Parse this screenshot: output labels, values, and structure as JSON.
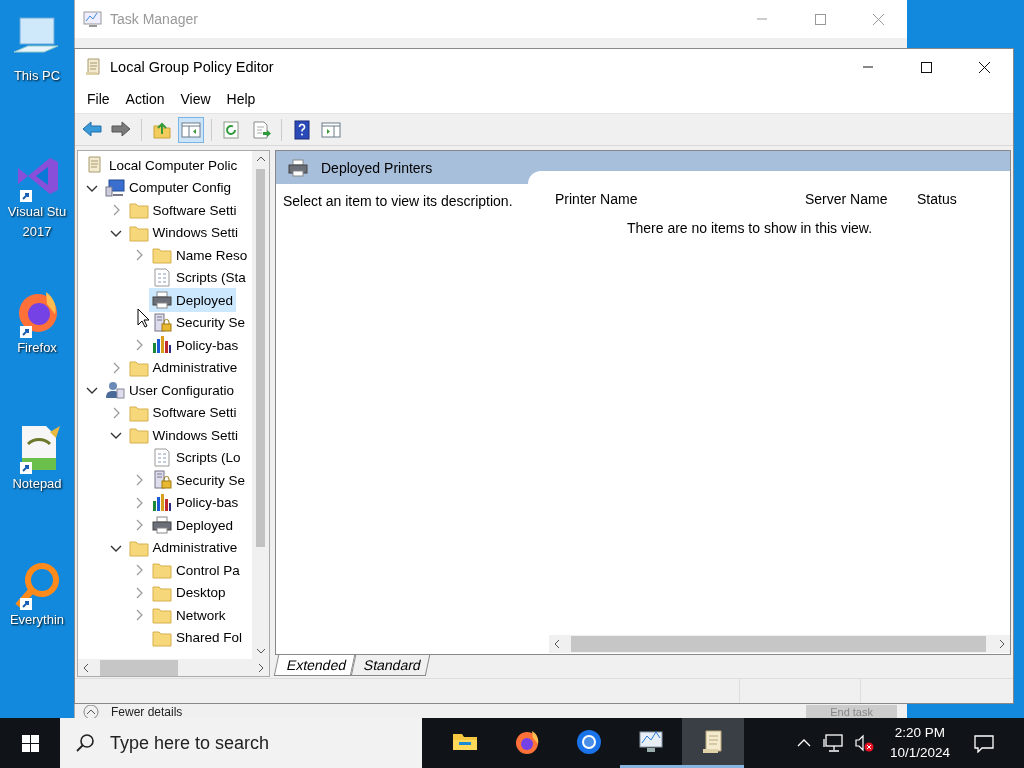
{
  "desktop_icons": [
    {
      "kind": "pc",
      "lines": [
        "This PC"
      ]
    },
    {
      "kind": "vs",
      "lines": [
        "Visual Stu",
        "2017"
      ]
    },
    {
      "kind": "firefox",
      "lines": [
        "Firefox"
      ]
    },
    {
      "kind": "notepad",
      "lines": [
        "Notepad"
      ]
    },
    {
      "kind": "search",
      "lines": [
        "Everythin"
      ]
    }
  ],
  "task_manager": {
    "title": "Task Manager",
    "details_link": "Fewer details",
    "end_task": {
      "label": "End task",
      "disabled": true
    }
  },
  "window": {
    "title": "Local Group Policy Editor",
    "menu": [
      "File",
      "Action",
      "View",
      "Help"
    ],
    "toolbar_groups": [
      [
        {
          "kind": "back",
          "pressed": false
        },
        {
          "kind": "forward",
          "pressed": false
        }
      ],
      [
        {
          "kind": "up",
          "pressed": false
        },
        {
          "kind": "console",
          "pressed": true
        }
      ],
      [
        {
          "kind": "refresh",
          "pressed": false
        },
        {
          "kind": "export",
          "pressed": false
        }
      ],
      [
        {
          "kind": "help",
          "pressed": false
        },
        {
          "kind": "pane",
          "pressed": false
        }
      ]
    ],
    "tree": [
      {
        "label": "Local Computer Polic",
        "kind": "scroll",
        "selected": false,
        "children": [
          {
            "label": "Computer Config",
            "kind": "computer",
            "has_children": true,
            "expanded": true,
            "selected": false,
            "children": [
              {
                "label": "Software Setti",
                "kind": "folder",
                "has_children": true,
                "expanded": false,
                "selected": false
              },
              {
                "label": "Windows Setti",
                "kind": "folder",
                "has_children": true,
                "expanded": true,
                "selected": false,
                "children": [
                  {
                    "label": "Name Reso",
                    "kind": "folder",
                    "has_children": true,
                    "expanded": false,
                    "selected": false
                  },
                  {
                    "label": "Scripts (Sta",
                    "kind": "script",
                    "has_children": false,
                    "selected": false
                  },
                  {
                    "label": "Deployed",
                    "kind": "printer",
                    "has_children": false,
                    "selected": true
                  },
                  {
                    "label": "Security Se",
                    "kind": "security",
                    "has_children": false,
                    "selected": false
                  },
                  {
                    "label": "Policy-bas",
                    "kind": "chart",
                    "has_children": true,
                    "expanded": false,
                    "selected": false
                  }
                ]
              },
              {
                "label": "Administrative",
                "kind": "folder",
                "has_children": true,
                "expanded": false,
                "selected": false
              }
            ]
          },
          {
            "label": "User Configuratio",
            "kind": "user",
            "has_children": true,
            "expanded": true,
            "selected": false,
            "children": [
              {
                "label": "Software Setti",
                "kind": "folder",
                "has_children": true,
                "expanded": false,
                "selected": false
              },
              {
                "label": "Windows Setti",
                "kind": "folder",
                "has_children": true,
                "expanded": true,
                "selected": false,
                "children": [
                  {
                    "label": "Scripts (Lo",
                    "kind": "script",
                    "has_children": false,
                    "selected": false
                  },
                  {
                    "label": "Security Se",
                    "kind": "security",
                    "has_children": true,
                    "expanded": false,
                    "selected": false
                  },
                  {
                    "label": "Policy-bas",
                    "kind": "chart",
                    "has_children": true,
                    "expanded": false,
                    "selected": false
                  },
                  {
                    "label": "Deployed",
                    "kind": "printer",
                    "has_children": true,
                    "expanded": false,
                    "selected": false
                  }
                ]
              },
              {
                "label": "Administrative",
                "kind": "folder",
                "has_children": true,
                "expanded": true,
                "selected": false,
                "children": [
                  {
                    "label": "Control Pa",
                    "kind": "folder",
                    "has_children": true,
                    "expanded": false,
                    "selected": false
                  },
                  {
                    "label": "Desktop",
                    "kind": "folder",
                    "has_children": true,
                    "expanded": false,
                    "selected": false
                  },
                  {
                    "label": "Network",
                    "kind": "folder",
                    "has_children": true,
                    "expanded": false,
                    "selected": false
                  },
                  {
                    "label": "Shared Fol",
                    "kind": "folder",
                    "has_children": false,
                    "selected": false
                  }
                ]
              }
            ]
          }
        ]
      }
    ],
    "details": {
      "title": "Deployed Printers",
      "description": "Select an item to view its description.",
      "columns": [
        "Printer Name",
        "Server Name",
        "Status"
      ],
      "empty_message": "There are no items to show in this view."
    },
    "view_tabs": [
      {
        "label": "Extended",
        "selected": true
      },
      {
        "label": "Standard",
        "selected": false
      }
    ]
  },
  "taskbar": {
    "search_placeholder": "Type here to search",
    "apps": [
      {
        "kind": "explorer",
        "running": false,
        "active": false
      },
      {
        "kind": "firefox",
        "running": false,
        "active": false
      },
      {
        "kind": "chrome",
        "running": false,
        "active": false
      },
      {
        "kind": "taskmgr",
        "running": true,
        "active": false
      },
      {
        "kind": "gpedit",
        "running": true,
        "active": true
      }
    ],
    "time": "2:20 PM",
    "date": "10/1/2024"
  }
}
